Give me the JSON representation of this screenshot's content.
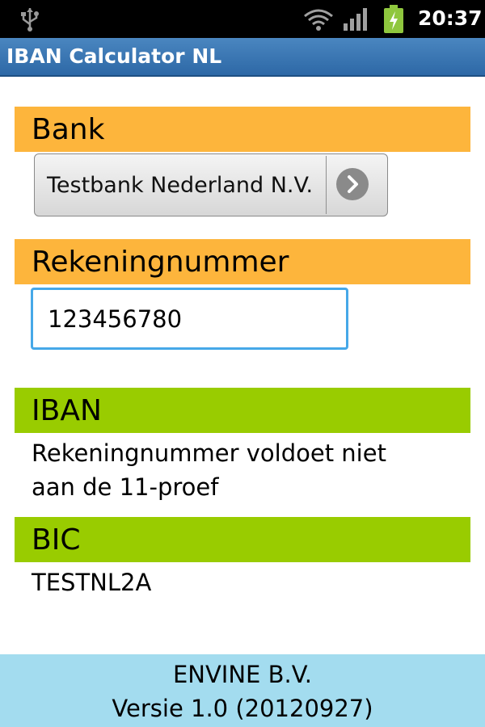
{
  "status_bar": {
    "time": "20:37",
    "icons": [
      "usb-icon",
      "wifi-icon",
      "signal-icon",
      "battery-charging-icon"
    ]
  },
  "app": {
    "title": "IBAN Calculator NL"
  },
  "bank_section": {
    "header": "Bank",
    "selected_bank": "Testbank Nederland N.V.",
    "arrow_icon": "chevron-right-icon"
  },
  "account_section": {
    "header": "Rekeningnummer",
    "value": "123456780"
  },
  "iban_section": {
    "header": "IBAN",
    "result_line1": "Rekeningnummer voldoet niet",
    "result_line2": "aan de 11-proef"
  },
  "bic_section": {
    "header": "BIC",
    "result": "TESTNL2A"
  },
  "footer": {
    "company": "ENVINE B.V.",
    "version": "Versie 1.0 (20120927)"
  },
  "colors": {
    "orange_header": "#fdb53c",
    "green_header": "#99cc00",
    "title_bar": "#3a78b5",
    "input_border": "#46a8e8",
    "footer_bg": "#a3dcef"
  }
}
